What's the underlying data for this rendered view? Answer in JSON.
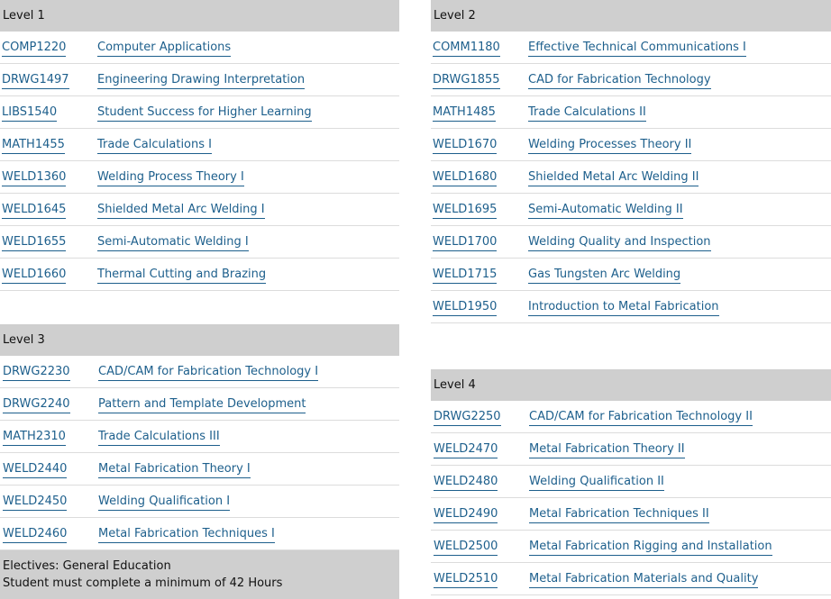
{
  "level1": {
    "title": "Level 1",
    "courses": [
      {
        "code": "COMP1220",
        "name": "Computer Applications"
      },
      {
        "code": "DRWG1497",
        "name": "Engineering Drawing Interpretation"
      },
      {
        "code": "LIBS1540",
        "name": "Student Success for Higher Learning"
      },
      {
        "code": "MATH1455",
        "name": "Trade Calculations I"
      },
      {
        "code": "WELD1360",
        "name": "Welding Process Theory I"
      },
      {
        "code": "WELD1645",
        "name": "Shielded Metal Arc Welding I"
      },
      {
        "code": "WELD1655",
        "name": "Semi-Automatic Welding I"
      },
      {
        "code": "WELD1660",
        "name": "Thermal Cutting and Brazing"
      }
    ]
  },
  "level2": {
    "title": "Level 2",
    "courses": [
      {
        "code": "COMM1180",
        "name": "Effective Technical Communications I"
      },
      {
        "code": "DRWG1855",
        "name": "CAD for Fabrication Technology"
      },
      {
        "code": "MATH1485",
        "name": "Trade Calculations II"
      },
      {
        "code": "WELD1670",
        "name": "Welding Processes Theory II"
      },
      {
        "code": "WELD1680",
        "name": "Shielded Metal Arc Welding II"
      },
      {
        "code": "WELD1695",
        "name": "Semi-Automatic Welding II"
      },
      {
        "code": "WELD1700",
        "name": "Welding Quality and Inspection"
      },
      {
        "code": "WELD1715",
        "name": "Gas Tungsten Arc Welding"
      },
      {
        "code": "WELD1950",
        "name": "Introduction to Metal Fabrication"
      }
    ]
  },
  "level3": {
    "title": "Level 3",
    "courses": [
      {
        "code": "DRWG2230",
        "name": "CAD/CAM for Fabrication Technology I"
      },
      {
        "code": "DRWG2240",
        "name": "Pattern and Template Development"
      },
      {
        "code": "MATH2310",
        "name": "Trade Calculations III"
      },
      {
        "code": "WELD2440",
        "name": "Metal Fabrication Theory I"
      },
      {
        "code": "WELD2450",
        "name": "Welding Qualification I"
      },
      {
        "code": "WELD2460",
        "name": "Metal Fabrication Techniques I"
      }
    ]
  },
  "level4": {
    "title": "Level 4",
    "courses": [
      {
        "code": "DRWG2250",
        "name": "CAD/CAM for Fabrication Technology II"
      },
      {
        "code": "WELD2470",
        "name": "Metal Fabrication Theory II"
      },
      {
        "code": "WELD2480",
        "name": "Welding Qualification II"
      },
      {
        "code": "WELD2490",
        "name": "Metal Fabrication Techniques II"
      },
      {
        "code": "WELD2500",
        "name": "Metal Fabrication Rigging and Installation"
      },
      {
        "code": "WELD2510",
        "name": "Metal Fabrication Materials and Quality"
      }
    ]
  },
  "electives": {
    "line1": "Electives: General Education",
    "line2": "Student must complete a minimum of 42 Hours"
  }
}
